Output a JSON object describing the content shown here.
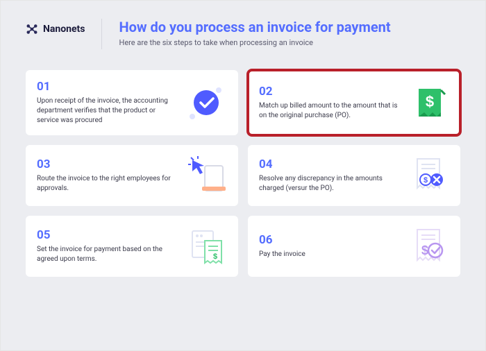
{
  "brand": {
    "name": "Nanonets"
  },
  "header": {
    "title": "How do you process an invoice for payment",
    "subtitle": "Here are the six steps to take when processing an invoice"
  },
  "steps": [
    {
      "num": "01",
      "text": "Upon receipt of the invoice, the accounting department verifies that the product or service was procured"
    },
    {
      "num": "02",
      "text": "Match up billed amount to the amount that is on the original purchase (PO)."
    },
    {
      "num": "03",
      "text": "Route the invoice to the right employees for approvals."
    },
    {
      "num": "04",
      "text": "Resolve any discrepancy in the amounts charged (versur the PO)."
    },
    {
      "num": "05",
      "text": "Set the invoice for payment based on the agreed upon terms."
    },
    {
      "num": "06",
      "text": "Pay the invoice"
    }
  ],
  "highlighted_index": 1
}
